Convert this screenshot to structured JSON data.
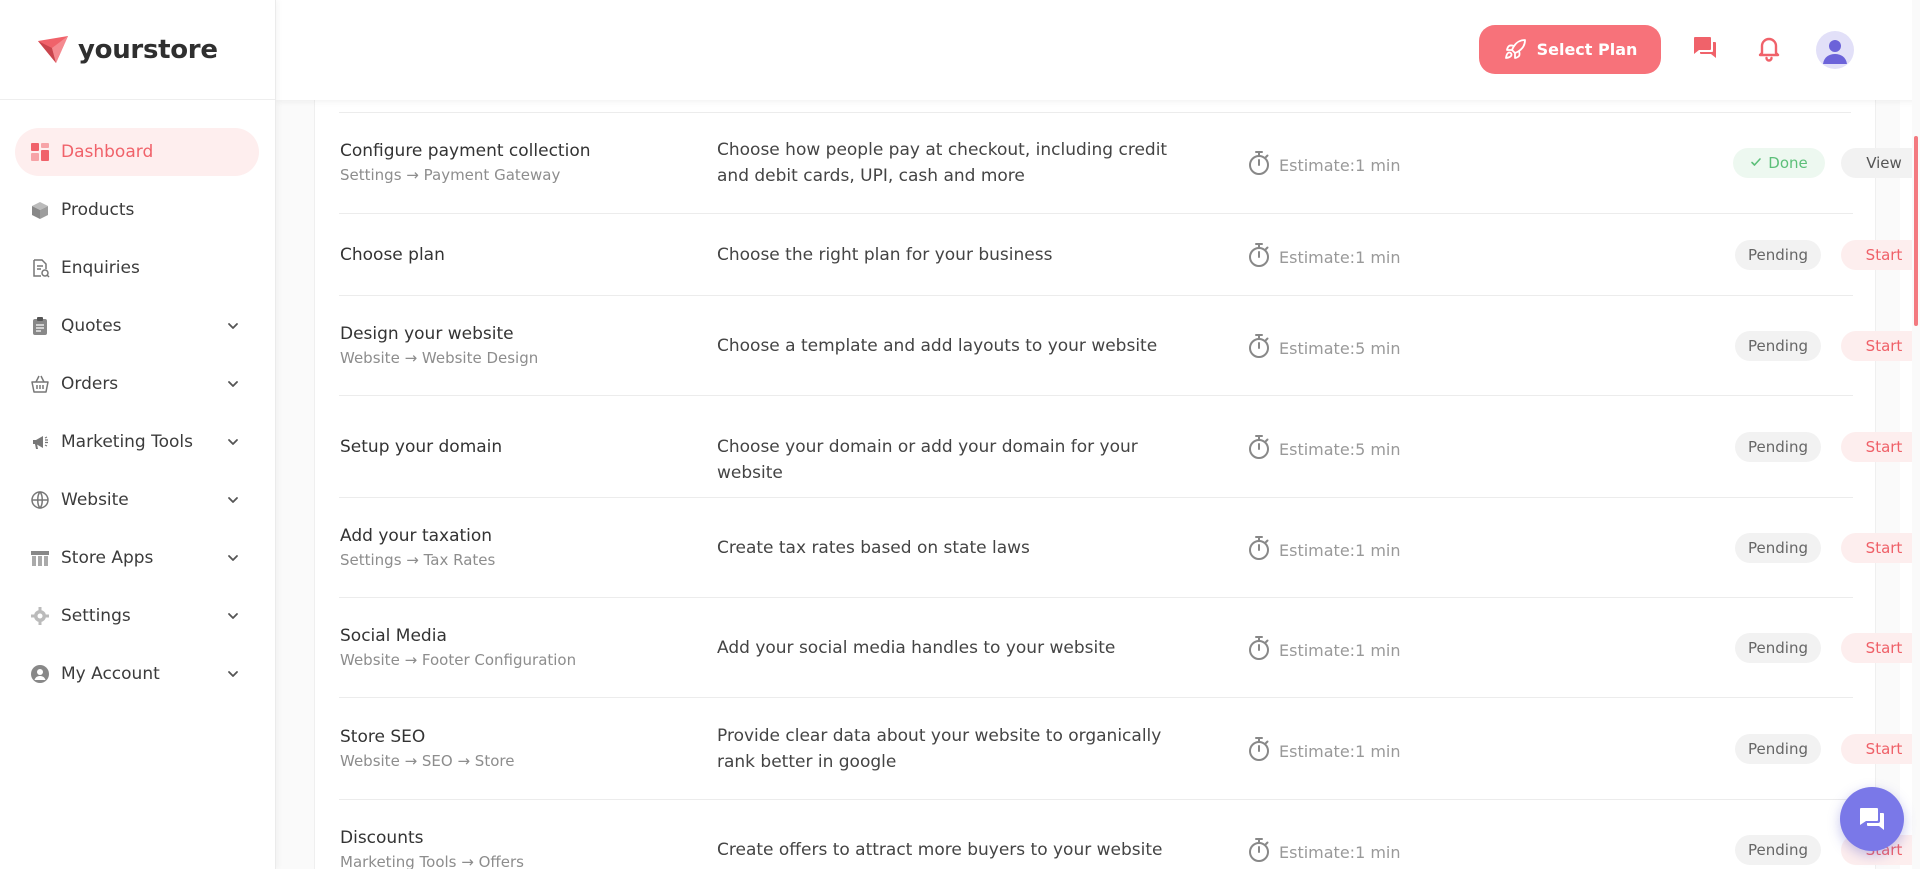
{
  "brand": {
    "name": "yourstore",
    "logo_icon": "paper-plane-logo",
    "accent_color": "#f0626a"
  },
  "sidebar": {
    "items": [
      {
        "label": "Dashboard",
        "icon": "dashboard-icon",
        "active": true,
        "expandable": false
      },
      {
        "label": "Products",
        "icon": "box-icon",
        "active": false,
        "expandable": false
      },
      {
        "label": "Enquiries",
        "icon": "document-search-icon",
        "active": false,
        "expandable": false
      },
      {
        "label": "Quotes",
        "icon": "clipboard-icon",
        "active": false,
        "expandable": true
      },
      {
        "label": "Orders",
        "icon": "basket-icon",
        "active": false,
        "expandable": true
      },
      {
        "label": "Marketing Tools",
        "icon": "megaphone-icon",
        "active": false,
        "expandable": true
      },
      {
        "label": "Website",
        "icon": "globe-icon",
        "active": false,
        "expandable": true
      },
      {
        "label": "Store Apps",
        "icon": "store-icon",
        "active": false,
        "expandable": true
      },
      {
        "label": "Settings",
        "icon": "gear-icon",
        "active": false,
        "expandable": true
      },
      {
        "label": "My Account",
        "icon": "user-circle-icon",
        "active": false,
        "expandable": true
      }
    ]
  },
  "header": {
    "select_plan_label": "Select Plan",
    "select_plan_icon": "rocket-icon",
    "chat_icon": "chat-icon",
    "bell_icon": "bell-icon",
    "avatar_icon": "user-avatar"
  },
  "tasks": [
    {
      "title": "Configure payment collection",
      "path": "Settings → Payment Gateway",
      "description": "Choose how people pay at checkout, including credit and debit cards, UPI, cash and more",
      "estimate": "Estimate:1 min",
      "status": "Done",
      "action": "View"
    },
    {
      "title": "Choose plan",
      "path": "",
      "description": "Choose the right plan for your business",
      "estimate": "Estimate:1 min",
      "status": "Pending",
      "action": "Start"
    },
    {
      "title": "Design your website",
      "path": "Website → Website Design",
      "description": "Choose a template and add layouts to your website",
      "estimate": "Estimate:5 min",
      "status": "Pending",
      "action": "Start"
    },
    {
      "title": "Setup your domain",
      "path": "",
      "description": "Choose your domain or add your domain for your website",
      "estimate": "Estimate:5 min",
      "status": "Pending",
      "action": "Start"
    },
    {
      "title": "Add your taxation",
      "path": "Settings → Tax Rates",
      "description": "Create tax rates based on state laws",
      "estimate": "Estimate:1 min",
      "status": "Pending",
      "action": "Start"
    },
    {
      "title": "Social Media",
      "path": "Website → Footer Configuration",
      "description": "Add your social media handles to your website",
      "estimate": "Estimate:1 min",
      "status": "Pending",
      "action": "Start"
    },
    {
      "title": "Store SEO",
      "path": "Website → SEO → Store",
      "description": "Provide clear data about your website to organically rank better in google",
      "estimate": "Estimate:1 min",
      "status": "Pending",
      "action": "Start"
    },
    {
      "title": "Discounts",
      "path": "Marketing Tools → Offers",
      "description": "Create offers to attract more buyers to your website",
      "estimate": "Estimate:1 min",
      "status": "Pending",
      "action": "Start"
    }
  ],
  "chat_widget": {
    "icon": "chat-bubble-icon"
  },
  "colors": {
    "accent": "#f7727a",
    "done": "#5cbf79",
    "chat": "#7a78e8"
  }
}
